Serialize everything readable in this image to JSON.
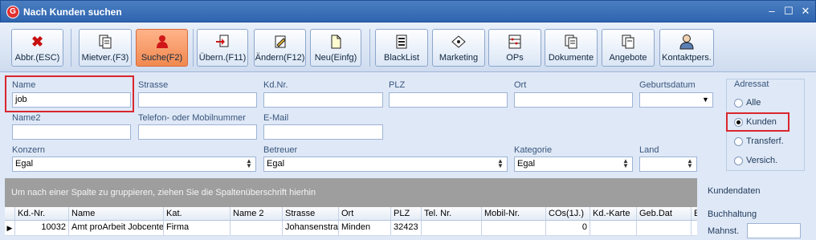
{
  "window": {
    "title": "Nach Kunden suchen",
    "app_icon_glyph": "G"
  },
  "toolbar": {
    "buttons": [
      {
        "key": "abbr",
        "label": "Abbr.(ESC)",
        "icon": "close-icon"
      },
      {
        "key": "mietver",
        "label": "Mietver.(F3)",
        "icon": "documents-icon"
      },
      {
        "key": "suche",
        "label": "Suche(F2)",
        "icon": "person-icon",
        "active": true
      },
      {
        "key": "uebern",
        "label": "Übern.(F11)",
        "icon": "import-icon"
      },
      {
        "key": "aendern",
        "label": "Ändern(F12)",
        "icon": "edit-icon"
      },
      {
        "key": "neu",
        "label": "Neu(Einfg)",
        "icon": "new-document-icon"
      },
      {
        "key": "blacklist",
        "label": "BlackList",
        "icon": "list-icon"
      },
      {
        "key": "marketing",
        "label": "Marketing",
        "icon": "tag-icon"
      },
      {
        "key": "ops",
        "label": "OPs",
        "icon": "abacus-icon"
      },
      {
        "key": "dokumente",
        "label": "Dokumente",
        "icon": "documents-icon"
      },
      {
        "key": "angebote",
        "label": "Angebote",
        "icon": "offers-icon"
      },
      {
        "key": "kontakt",
        "label": "Kontaktpers.",
        "icon": "contact-person-icon"
      }
    ]
  },
  "form": {
    "name": {
      "label": "Name",
      "value": "job"
    },
    "strasse": {
      "label": "Strasse",
      "value": ""
    },
    "kdnr": {
      "label": "Kd.Nr.",
      "value": ""
    },
    "plz": {
      "label": "PLZ",
      "value": ""
    },
    "ort": {
      "label": "Ort",
      "value": ""
    },
    "geburtsdatum": {
      "label": "Geburtsdatum",
      "value": ""
    },
    "name2": {
      "label": "Name2",
      "value": ""
    },
    "telefon": {
      "label": "Telefon- oder Mobilnummer",
      "value": ""
    },
    "email": {
      "label": "E-Mail",
      "value": ""
    },
    "konzern": {
      "label": "Konzern",
      "value": "Egal"
    },
    "betreuer": {
      "label": "Betreuer",
      "value": "Egal"
    },
    "kategorie": {
      "label": "Kategorie",
      "value": "Egal"
    },
    "land": {
      "label": "Land",
      "value": ""
    }
  },
  "adressat": {
    "title": "Adressat",
    "options": [
      "Alle",
      "Kunden",
      "Transferf.",
      "Versich."
    ],
    "selected": "Kunden"
  },
  "grid": {
    "group_hint": "Um nach einer Spalte zu gruppieren, ziehen Sie die Spaltenüberschrift hierhin",
    "columns": [
      "Kd.-Nr.",
      "Name",
      "Kat.",
      "Name 2",
      "Strasse",
      "Ort",
      "PLZ",
      "Tel. Nr.",
      "Mobil-Nr.",
      "COs(1J.)",
      "Kd.-Karte",
      "Geb.Dat",
      "E"
    ],
    "rows": [
      [
        "10032",
        "Amt proArbeit Jobcenter",
        "Firma",
        "",
        "Johansenstraße",
        "Minden",
        "32423",
        "",
        "",
        "0",
        "",
        "",
        ""
      ]
    ]
  },
  "side": {
    "kundendaten": "Kundendaten",
    "buchhaltung": "Buchhaltung",
    "mahnst_label": "Mahnst."
  },
  "colors": {
    "titlebar": "#2f65b0",
    "active_button": "#f0894f",
    "highlight_red": "#d9262e"
  }
}
